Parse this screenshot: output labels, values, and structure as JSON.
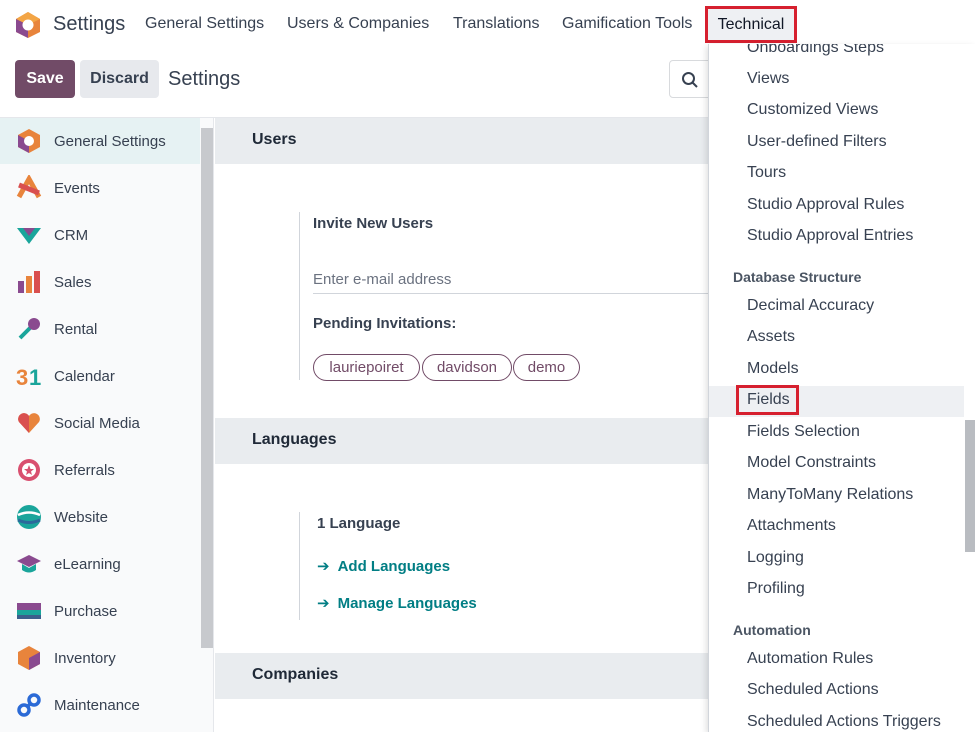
{
  "app": {
    "title": "Settings"
  },
  "nav": {
    "items": [
      "General Settings",
      "Users & Companies",
      "Translations",
      "Gamification Tools"
    ],
    "technical": "Technical"
  },
  "control": {
    "save": "Save",
    "discard": "Discard",
    "title": "Settings"
  },
  "sidebar": {
    "items": [
      {
        "label": "General Settings",
        "icon": "general-settings-icon"
      },
      {
        "label": "Events",
        "icon": "events-icon"
      },
      {
        "label": "CRM",
        "icon": "crm-icon"
      },
      {
        "label": "Sales",
        "icon": "sales-icon"
      },
      {
        "label": "Rental",
        "icon": "rental-icon"
      },
      {
        "label": "Calendar",
        "icon": "calendar-icon"
      },
      {
        "label": "Social Media",
        "icon": "social-media-icon"
      },
      {
        "label": "Referrals",
        "icon": "referrals-icon"
      },
      {
        "label": "Website",
        "icon": "website-icon"
      },
      {
        "label": "eLearning",
        "icon": "elearning-icon"
      },
      {
        "label": "Purchase",
        "icon": "purchase-icon"
      },
      {
        "label": "Inventory",
        "icon": "inventory-icon"
      },
      {
        "label": "Maintenance",
        "icon": "maintenance-icon"
      }
    ]
  },
  "users": {
    "heading": "Users",
    "invite_label": "Invite New Users",
    "email_placeholder": "Enter e-mail address",
    "pending_label": "Pending Invitations:",
    "tags": [
      "lauriepoiret",
      "davidson",
      "demo"
    ]
  },
  "languages": {
    "heading": "Languages",
    "count": "1 Language",
    "add": "Add Languages",
    "manage": "Manage Languages"
  },
  "companies": {
    "heading": "Companies"
  },
  "dropdown": {
    "items_top": [
      "Onboardings Steps",
      "Views",
      "Customized Views",
      "User-defined Filters",
      "Tours",
      "Studio Approval Rules",
      "Studio Approval Entries"
    ],
    "header_db": "Database Structure",
    "items_db": [
      "Decimal Accuracy",
      "Assets",
      "Models",
      "Fields",
      "Fields Selection",
      "Model Constraints",
      "ManyToMany Relations",
      "Attachments",
      "Logging",
      "Profiling"
    ],
    "header_auto": "Automation",
    "items_auto": [
      "Automation Rules",
      "Scheduled Actions",
      "Scheduled Actions Triggers"
    ]
  },
  "colors": {
    "brand": "#714b67",
    "link": "#017e84",
    "highlight": "#d6202f"
  }
}
